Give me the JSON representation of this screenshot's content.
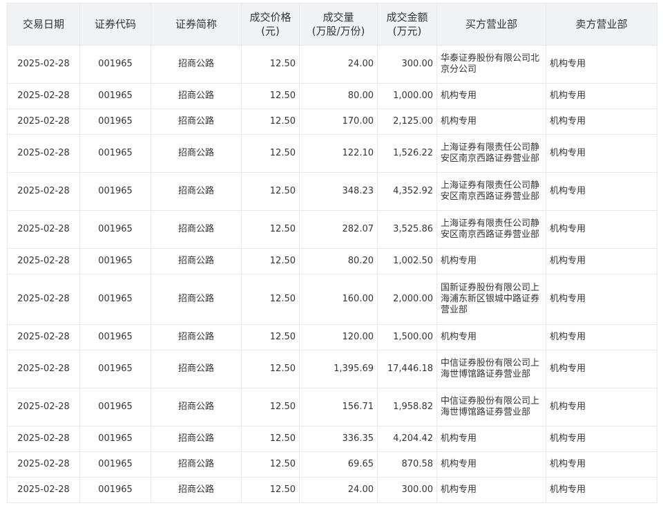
{
  "headers": [
    {
      "line1": "交易日期",
      "line2": ""
    },
    {
      "line1": "证券代码",
      "line2": ""
    },
    {
      "line1": "证券简称",
      "line2": ""
    },
    {
      "line1": "成交价格",
      "line2": "(元)"
    },
    {
      "line1": "成交量",
      "line2": "(万股/万份)"
    },
    {
      "line1": "成交金额",
      "line2": "(万元)"
    },
    {
      "line1": "买方营业部",
      "line2": ""
    },
    {
      "line1": "卖方营业部",
      "line2": ""
    }
  ],
  "rows": [
    {
      "date": "2025-02-28",
      "code": "001965",
      "name": "招商公路",
      "price": "12.50",
      "volume": "24.00",
      "amount": "300.00",
      "buyer": "华泰证券股份有限公司北京分公司",
      "seller": "机构专用"
    },
    {
      "date": "2025-02-28",
      "code": "001965",
      "name": "招商公路",
      "price": "12.50",
      "volume": "80.00",
      "amount": "1,000.00",
      "buyer": "机构专用",
      "seller": "机构专用"
    },
    {
      "date": "2025-02-28",
      "code": "001965",
      "name": "招商公路",
      "price": "12.50",
      "volume": "170.00",
      "amount": "2,125.00",
      "buyer": "机构专用",
      "seller": "机构专用"
    },
    {
      "date": "2025-02-28",
      "code": "001965",
      "name": "招商公路",
      "price": "12.50",
      "volume": "122.10",
      "amount": "1,526.22",
      "buyer": "上海证券有限责任公司静安区南京西路证券营业部",
      "seller": "机构专用"
    },
    {
      "date": "2025-02-28",
      "code": "001965",
      "name": "招商公路",
      "price": "12.50",
      "volume": "348.23",
      "amount": "4,352.92",
      "buyer": "上海证券有限责任公司静安区南京西路证券营业部",
      "seller": "机构专用"
    },
    {
      "date": "2025-02-28",
      "code": "001965",
      "name": "招商公路",
      "price": "12.50",
      "volume": "282.07",
      "amount": "3,525.86",
      "buyer": "上海证券有限责任公司静安区南京西路证券营业部",
      "seller": "机构专用"
    },
    {
      "date": "2025-02-28",
      "code": "001965",
      "name": "招商公路",
      "price": "12.50",
      "volume": "80.20",
      "amount": "1,002.50",
      "buyer": "机构专用",
      "seller": "机构专用"
    },
    {
      "date": "2025-02-28",
      "code": "001965",
      "name": "招商公路",
      "price": "12.50",
      "volume": "160.00",
      "amount": "2,000.00",
      "buyer": "国新证券股份有限公司上海浦东新区银城中路证券营业部",
      "seller": "机构专用"
    },
    {
      "date": "2025-02-28",
      "code": "001965",
      "name": "招商公路",
      "price": "12.50",
      "volume": "120.00",
      "amount": "1,500.00",
      "buyer": "机构专用",
      "seller": "机构专用"
    },
    {
      "date": "2025-02-28",
      "code": "001965",
      "name": "招商公路",
      "price": "12.50",
      "volume": "1,395.69",
      "amount": "17,446.18",
      "buyer": "中信证券股份有限公司上海世博馆路证券营业部",
      "seller": "机构专用"
    },
    {
      "date": "2025-02-28",
      "code": "001965",
      "name": "招商公路",
      "price": "12.50",
      "volume": "156.71",
      "amount": "1,958.82",
      "buyer": "中信证券股份有限公司上海世博馆路证券营业部",
      "seller": "机构专用"
    },
    {
      "date": "2025-02-28",
      "code": "001965",
      "name": "招商公路",
      "price": "12.50",
      "volume": "336.35",
      "amount": "4,204.42",
      "buyer": "机构专用",
      "seller": "机构专用"
    },
    {
      "date": "2025-02-28",
      "code": "001965",
      "name": "招商公路",
      "price": "12.50",
      "volume": "69.65",
      "amount": "870.58",
      "buyer": "机构专用",
      "seller": "机构专用"
    },
    {
      "date": "2025-02-28",
      "code": "001965",
      "name": "招商公路",
      "price": "12.50",
      "volume": "24.00",
      "amount": "300.00",
      "buyer": "机构专用",
      "seller": "机构专用"
    }
  ]
}
